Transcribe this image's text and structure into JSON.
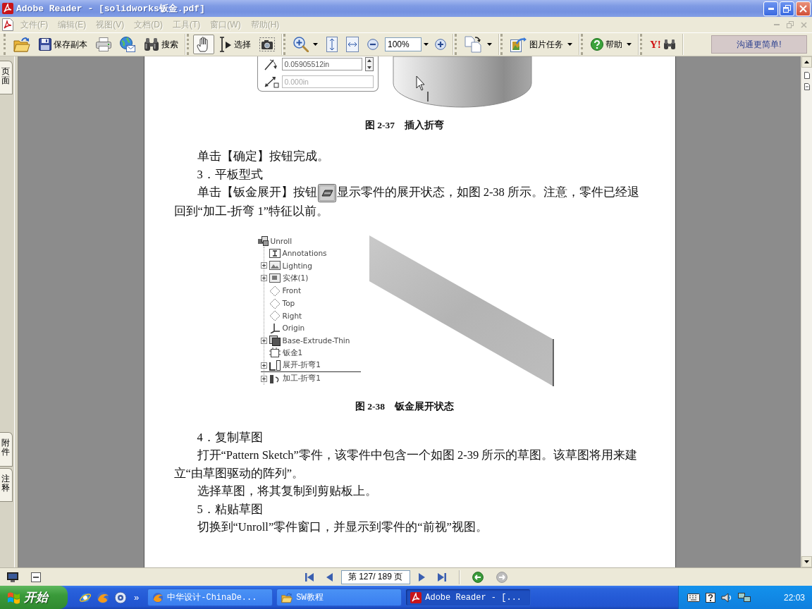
{
  "window": {
    "title": "Adobe Reader - [solidworks钣金.pdf]"
  },
  "menu_bar": {
    "items": [
      {
        "label": "文件(F)",
        "disabled": true
      },
      {
        "label": "编辑(E)",
        "disabled": true
      },
      {
        "label": "视图(V)",
        "disabled": true
      },
      {
        "label": "文档(D)",
        "disabled": true
      },
      {
        "label": "工具(T)",
        "disabled": true
      },
      {
        "label": "窗口(W)",
        "disabled": true
      },
      {
        "label": "帮助(H)",
        "disabled": true
      }
    ]
  },
  "toolbar": {
    "groups": [
      {
        "items": [
          {
            "kind": "open"
          },
          {
            "kind": "save",
            "label": "保存副本"
          },
          {
            "kind": "print"
          },
          {
            "kind": "email"
          },
          {
            "kind": "search",
            "label": "搜索"
          }
        ]
      },
      {
        "items": [
          {
            "kind": "hand",
            "selected": true
          },
          {
            "kind": "select",
            "label": "选择",
            "selected": false
          },
          {
            "kind": "snapshot",
            "selected": false
          }
        ]
      },
      {
        "items": [
          {
            "kind": "zoom_in",
            "dropdown": true
          },
          {
            "kind": "fit_page"
          },
          {
            "kind": "fit_width"
          },
          {
            "kind": "zoom_out"
          },
          {
            "kind": "zoom_field",
            "value": "100%",
            "dropdown": true
          },
          {
            "kind": "zoom_plus"
          }
        ]
      },
      {
        "items": [
          {
            "kind": "rotate",
            "dropdown": true
          }
        ]
      },
      {
        "items": [
          {
            "kind": "picture_tasks",
            "label": "图片任务",
            "dropdown": true
          }
        ]
      },
      {
        "items": [
          {
            "kind": "help",
            "label": "帮助",
            "dropdown": true
          }
        ]
      },
      {
        "items": [
          {
            "kind": "yahoo",
            "label": "Y!"
          }
        ]
      }
    ],
    "promo": "沟通更简单!"
  },
  "side_panel": {
    "top_tabs": [
      {
        "label": "页面",
        "selected": false
      }
    ],
    "bottom_tabs": [
      {
        "label": "附件",
        "selected": false
      },
      {
        "label": "注释",
        "selected": false
      }
    ]
  },
  "document": {
    "blocks": [
      {
        "kind": "dialog_figure",
        "fields": [
          {
            "value": "0.05905512in",
            "spinner": true,
            "disabled": false
          },
          {
            "value": "0.000in",
            "spinner": false,
            "disabled": true
          }
        ]
      },
      {
        "kind": "caption",
        "text": "图 2-37　插入折弯"
      },
      {
        "kind": "paragraph",
        "text": "单击【确定】按钮完成。"
      },
      {
        "kind": "heading",
        "text": "3．平板型式"
      },
      {
        "kind": "paragraph_icon",
        "before": "单击【钣金展开】按钮",
        "after": "显示零件的展开状态，如图 2-38 所示。注意，零件已经退回到“加工-折弯 1”特征以前。"
      },
      {
        "kind": "tree_figure",
        "tree": {
          "label": "Unroll",
          "kind": "part",
          "children": [
            {
              "label": "Annotations",
              "kind": "annotations",
              "expandable": false
            },
            {
              "label": "Lighting",
              "kind": "lighting",
              "expandable": true
            },
            {
              "label": "实体(1)",
              "kind": "bodies",
              "expandable": true
            },
            {
              "label": "Front",
              "kind": "plane",
              "expandable": false
            },
            {
              "label": "Top",
              "kind": "plane",
              "expandable": false
            },
            {
              "label": "Right",
              "kind": "plane",
              "expandable": false
            },
            {
              "label": "Origin",
              "kind": "origin",
              "expandable": false
            },
            {
              "label": "Base-Extrude-Thin",
              "kind": "extrude",
              "expandable": true
            },
            {
              "label": "钣金1",
              "kind": "sheet_metal",
              "expandable": false
            },
            {
              "label": "展开-折弯1",
              "kind": "flatten",
              "expandable": true
            },
            {
              "label": "加工-折弯1",
              "kind": "process_bend",
              "expandable": true,
              "rolled_back": true
            }
          ]
        }
      },
      {
        "kind": "caption",
        "text": "图 2-38　钣金展开状态"
      },
      {
        "kind": "heading",
        "text": "4．复制草图"
      },
      {
        "kind": "paragraph",
        "text": "打开“Pattern Sketch”零件，该零件中包含一个如图 2-39 所示的草图。该草图将用来建立“由草图驱动的阵列”。"
      },
      {
        "kind": "paragraph",
        "text": "选择草图，将其复制到剪贴板上。"
      },
      {
        "kind": "heading",
        "text": "5．粘贴草图"
      },
      {
        "kind": "paragraph",
        "text": "切换到“Unroll”零件窗口，并显示到零件的“前视”视图。"
      }
    ]
  },
  "status_bar": {
    "navigation": [
      {
        "kind": "first_page"
      },
      {
        "kind": "previous_page"
      },
      {
        "kind": "page_field",
        "value": "第 127/ 189 页"
      },
      {
        "kind": "next_page"
      },
      {
        "kind": "last_page"
      },
      {
        "kind": "separator"
      },
      {
        "kind": "back",
        "disabled": false
      },
      {
        "kind": "forward",
        "disabled": true
      }
    ]
  },
  "taskbar": {
    "start": "开始",
    "quick_launch_more": "»",
    "tasks": [
      {
        "label": "中华设计-ChinaDe...",
        "kind": "browser",
        "selected": false
      },
      {
        "label": "SW教程",
        "kind": "folder",
        "selected": false
      },
      {
        "label": "Adobe Reader - [...",
        "kind": "reader",
        "selected": true
      }
    ],
    "clock": "22:03"
  }
}
